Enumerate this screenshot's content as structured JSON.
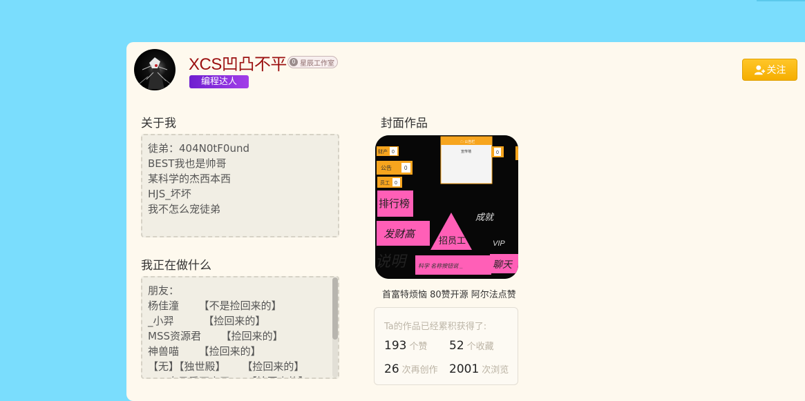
{
  "profile": {
    "username": "XCS凹凸不平",
    "studio_level": "0",
    "studio_name": "星辰工作室",
    "role_tag": "编程达人",
    "follow_label": "关注"
  },
  "about": {
    "title": "关于我",
    "text": "徒弟：404N0tF0und\nBEST我也是帅哥\n某科学的杰西本西\nHJS_坏坏\n我不怎么宠徒弟"
  },
  "doing": {
    "title": "我正在做什么",
    "text": "朋友：\n杨佳潼      【不是捡回来的】\n_小羿         【捡回来的】\nMSS资源君      【捡回来的】\n神兽喵      【捡回来的】\n【无】【独世殿】     【捡回来的】\nZSY自己看不来了     【捡回来的】"
  },
  "cover": {
    "title": "封面作品",
    "work_title": "首富特烦恼 80赞开源 阿尔法点赞",
    "thumb": {
      "panel_title": "☁ 公告栏",
      "panel_text": "宣传墙",
      "tag_money": "财产",
      "tag_money_val": "0",
      "tag_notice": "公告",
      "tag_notice_val": "0",
      "tag_staff": "员工",
      "tag_staff_val": "0",
      "tag_right_val": "0",
      "rank": "排行榜",
      "get_rich": "发财高",
      "hire": "招员工",
      "combat": "成就",
      "vip": "VIP",
      "explain": "说明",
      "chat": "聊天",
      "bottom_note": "科学  名称按钮说 _"
    }
  },
  "stats": {
    "heading": "Ta的作品已经累积获得了:",
    "items": [
      {
        "num": "193",
        "unit": "个赞"
      },
      {
        "num": "52",
        "unit": "个收藏"
      },
      {
        "num": "26",
        "unit": "次再创作"
      },
      {
        "num": "2001",
        "unit": "次浏览"
      }
    ]
  },
  "colors": {
    "page_bg": "#7addfd",
    "panel_bg": "#fef9ee",
    "username": "#9b1010",
    "accent": "#f5ae00",
    "role_tag": "#7a25d8"
  }
}
